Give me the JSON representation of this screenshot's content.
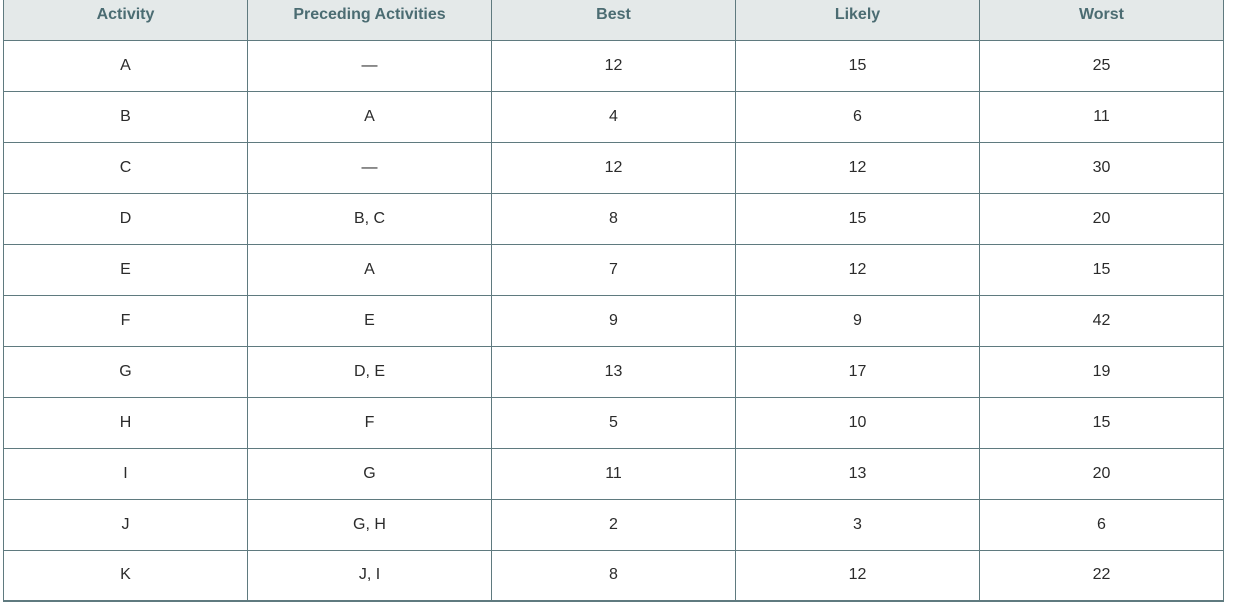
{
  "table": {
    "headers": [
      "Activity",
      "Preceding Activities",
      "Best",
      "Likely",
      "Worst"
    ],
    "rows": [
      {
        "activity": "A",
        "preceding": "—",
        "best": "12",
        "likely": "15",
        "worst": "25"
      },
      {
        "activity": "B",
        "preceding": "A",
        "best": "4",
        "likely": "6",
        "worst": "11"
      },
      {
        "activity": "C",
        "preceding": "—",
        "best": "12",
        "likely": "12",
        "worst": "30"
      },
      {
        "activity": "D",
        "preceding": "B, C",
        "best": "8",
        "likely": "15",
        "worst": "20"
      },
      {
        "activity": "E",
        "preceding": "A",
        "best": "7",
        "likely": "12",
        "worst": "15"
      },
      {
        "activity": "F",
        "preceding": "E",
        "best": "9",
        "likely": "9",
        "worst": "42"
      },
      {
        "activity": "G",
        "preceding": "D, E",
        "best": "13",
        "likely": "17",
        "worst": "19"
      },
      {
        "activity": "H",
        "preceding": "F",
        "best": "5",
        "likely": "10",
        "worst": "15"
      },
      {
        "activity": "I",
        "preceding": "G",
        "best": "11",
        "likely": "13",
        "worst": "20"
      },
      {
        "activity": "J",
        "preceding": "G, H",
        "best": "2",
        "likely": "3",
        "worst": "6"
      },
      {
        "activity": "K",
        "preceding": "J, I",
        "best": "8",
        "likely": "12",
        "worst": "22"
      }
    ]
  },
  "colors": {
    "header_bg": "#e4e9e9",
    "header_text": "#4b6c72",
    "border": "#5f7a7f",
    "cell_text": "#2b2b2b"
  }
}
